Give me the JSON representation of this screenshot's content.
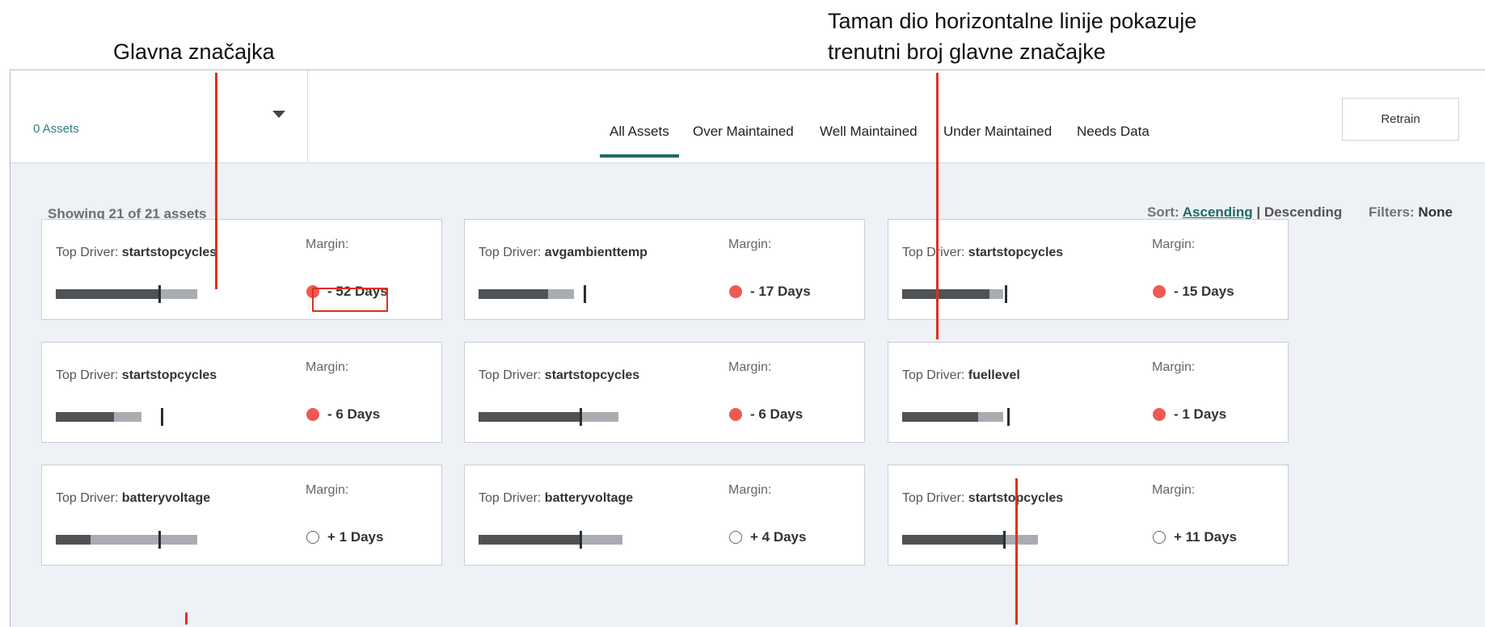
{
  "annotations": {
    "top_driver": "Glavna značajka",
    "dark_part_line1": "Taman dio horizontalne linije pokazuje",
    "dark_part_line2": "trenutni broj glavne značajke"
  },
  "header": {
    "asset_count": "0 Assets",
    "tabs": [
      "All Assets",
      "Over Maintained",
      "Well Maintained",
      "Under Maintained",
      "Needs Data"
    ],
    "active_tab": "All Assets",
    "retrain_label": "Retrain"
  },
  "toolbar": {
    "showing": "Showing 21 of 21 assets",
    "sort_label": "Sort:",
    "sort_ascending": "Ascending",
    "sort_separator": "|",
    "sort_descending": "Descending",
    "filters_label": "Filters:",
    "filters_value": "None"
  },
  "card_labels": {
    "driver_prefix": "Top Driver:",
    "margin": "Margin:"
  },
  "cards": [
    {
      "driver": "startstopcycles",
      "margin": "- 52 Days",
      "status": "red",
      "dark": 0.53,
      "light": 0.73,
      "marker": 0.53
    },
    {
      "driver": "avgambienttemp",
      "margin": "- 17 Days",
      "status": "red",
      "dark": 0.36,
      "light": 0.49,
      "marker": 0.54
    },
    {
      "driver": "startstopcycles",
      "margin": "- 15 Days",
      "status": "red",
      "dark": 0.45,
      "light": 0.52,
      "marker": 0.53
    },
    {
      "driver": "startstopcycles",
      "margin": "- 6 Days",
      "status": "red",
      "dark": 0.3,
      "light": 0.44,
      "marker": 0.54
    },
    {
      "driver": "startstopcycles",
      "margin": "- 6 Days",
      "status": "red",
      "dark": 0.52,
      "light": 0.72,
      "marker": 0.52
    },
    {
      "driver": "fuellevel",
      "margin": "- 1 Days",
      "status": "red",
      "dark": 0.39,
      "light": 0.52,
      "marker": 0.54
    },
    {
      "driver": "batteryvoltage",
      "margin": "+ 1 Days",
      "status": "empty",
      "dark": 0.18,
      "light": 0.73,
      "marker": 0.53
    },
    {
      "driver": "batteryvoltage",
      "margin": "+ 4 Days",
      "status": "empty",
      "dark": 0.52,
      "light": 0.74,
      "marker": 0.52
    },
    {
      "driver": "startstopcycles",
      "margin": "+ 11 Days",
      "status": "empty",
      "dark": 0.52,
      "light": 0.7,
      "marker": 0.52
    }
  ]
}
